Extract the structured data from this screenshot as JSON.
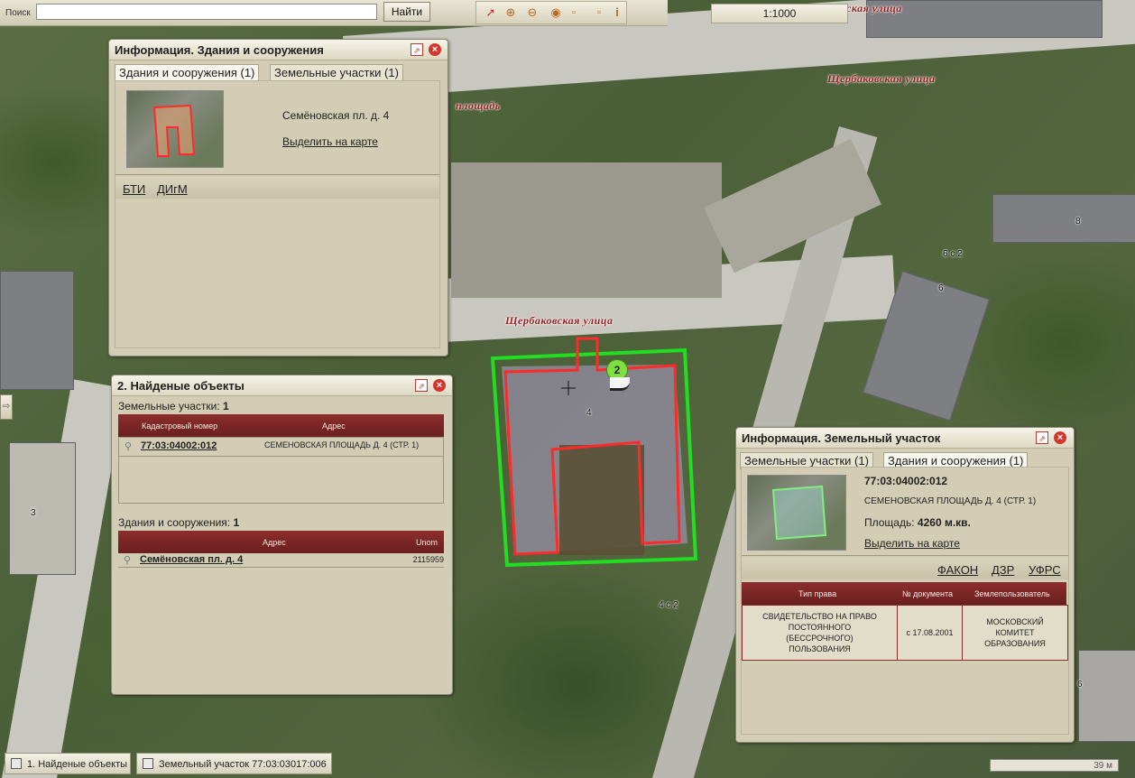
{
  "toolbar": {
    "search_label": "Поиск",
    "search_value": "",
    "search_button": "Найти",
    "scale": "1:1000",
    "tools": [
      "pointer-icon",
      "zoom-in-icon",
      "zoom-out-icon",
      "zoom-extent-icon",
      "select-rect-icon",
      "info-icon"
    ]
  },
  "map": {
    "streets": [
      "Щербаковская улица",
      "Щербаковская улица",
      "ская улица",
      "площадь"
    ],
    "house_numbers": [
      "8",
      "6 с.2",
      "6",
      "4",
      "4 с.2",
      "3",
      "6"
    ],
    "marker_number": "2",
    "colors": {
      "building_outline": "#ff2a2a",
      "parcel_outline": "#22dd22"
    }
  },
  "buildings_window": {
    "title": "Информация. Здания и сооружения",
    "tabs": [
      {
        "label": "Здания и сооружения (1)",
        "active": true
      },
      {
        "label": "Земельные участки (1)",
        "active": false
      }
    ],
    "address": "Семёновская пл. д. 4",
    "highlight_link": "Выделить на карте",
    "links": [
      "БТИ",
      "ДИгМ"
    ]
  },
  "found_window": {
    "title": "2. Найденые объекты",
    "parcels": {
      "heading": "Земельные участки:",
      "count": "1",
      "columns": [
        "Кадастровый номер",
        "Адрес"
      ],
      "rows": [
        {
          "cadastral": "77:03:04002:012",
          "address": "СЕМЕНОВСКАЯ ПЛОЩАДЬ Д. 4 (СТР. 1)"
        }
      ]
    },
    "buildings": {
      "heading": "Здания и сооружения:",
      "count": "1",
      "columns": [
        "Адрес",
        "Unom"
      ],
      "rows": [
        {
          "address": "Семёновская пл. д. 4",
          "unom": "2115959"
        }
      ]
    }
  },
  "parcel_window": {
    "title": "Информация. Земельный участок",
    "tabs": [
      {
        "label": "Земельные участки (1)",
        "active": false
      },
      {
        "label": "Здания и сооружения (1)",
        "active": true
      }
    ],
    "cadastral": "77:03:04002:012",
    "address": "СЕМЕНОВСКАЯ ПЛОЩАДЬ Д. 4 (СТР. 1)",
    "area_label": "Площадь:",
    "area_value": "4260 м.кв.",
    "highlight_link": "Выделить на карте",
    "links": [
      "ФАКОН",
      "ДЗР",
      "УФРС"
    ],
    "columns": [
      "Тип права",
      "№ документа",
      "Землепользователь"
    ],
    "rows": [
      {
        "right_type": "СВИДЕТЕЛЬСТВО НА ПРАВО ПОСТОЯННОГО (БЕССРОЧНОГО) ПОЛЬЗОВАНИЯ",
        "doc": "с 17.08.2001",
        "user": "МОСКОВСКИЙ КОМИТЕТ ОБРАЗОВАНИЯ"
      }
    ]
  },
  "taskbar": {
    "items": [
      "1. Найденые объекты",
      "Земельный участок 77:03:03017:006"
    ],
    "ruler": "39 м"
  }
}
